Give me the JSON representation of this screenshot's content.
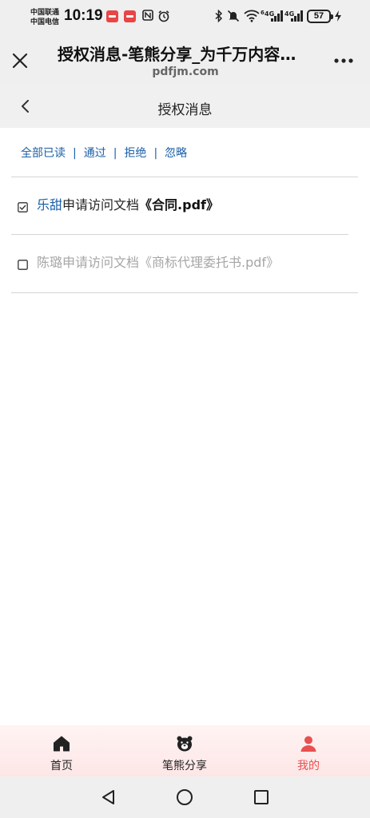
{
  "status_bar": {
    "carrier_1": "中国联通",
    "carrier_2": "中国电信",
    "time": "10:19",
    "network_1": "4G",
    "network_2": "4G",
    "wifi_label": "6",
    "battery": "57",
    "icons": [
      "app-badge-icon",
      "app-badge-icon",
      "nfc-icon",
      "alarm-icon",
      "bluetooth-icon",
      "mute-icon",
      "wifi-icon",
      "signal-icon",
      "signal-icon",
      "battery-icon",
      "charging-icon"
    ]
  },
  "browser": {
    "title": "授权消息-笔熊分享_为千万内容创作者提供文件分享服务",
    "domain": "pdfjm.com"
  },
  "page": {
    "nav_title": "授权消息",
    "actions": [
      {
        "label": "全部已读"
      },
      {
        "label": "通过"
      },
      {
        "label": "拒绝"
      },
      {
        "label": "忽略"
      }
    ],
    "separator": "|",
    "messages": [
      {
        "checked": true,
        "requester": "乐甜",
        "action_text": "申请访问文档",
        "document": "《合同.pdf》",
        "state": "read"
      },
      {
        "checked": false,
        "requester": "陈璐",
        "action_text": "申请访问文档",
        "document": "《商标代理委托书.pdf》",
        "state": "unread"
      }
    ]
  },
  "tab_bar": {
    "tabs": [
      {
        "label": "首页",
        "icon": "home-icon",
        "active": false
      },
      {
        "label": "笔熊分享",
        "icon": "bear-icon",
        "active": false
      },
      {
        "label": "我的",
        "icon": "person-icon",
        "active": true
      }
    ]
  },
  "colors": {
    "link_blue": "#1a5ea8",
    "active_red": "#e8514f",
    "muted_gray": "#a6a6a6",
    "header_bg": "#efefef"
  }
}
